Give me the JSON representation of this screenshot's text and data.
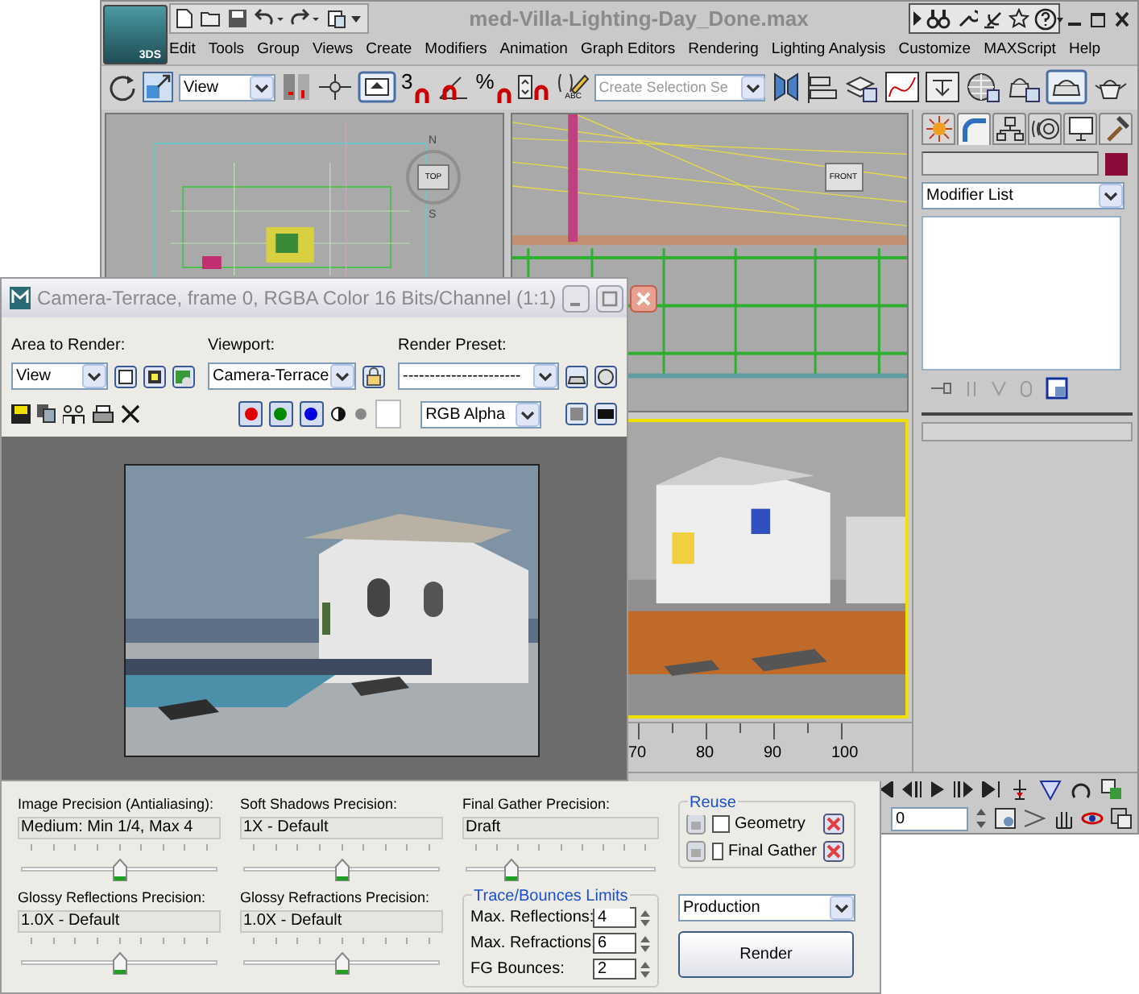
{
  "max_window": {
    "logo": "3DS",
    "title": "med-Villa-Lighting-Day_Done.max",
    "menu": [
      "Edit",
      "Tools",
      "Group",
      "Views",
      "Create",
      "Modifiers",
      "Animation",
      "Graph Editors",
      "Rendering",
      "Lighting Analysis",
      "Customize",
      "MAXScript",
      "Help"
    ],
    "toolbar": {
      "reference_coordinate": "View",
      "snap_label": "3",
      "percent_snap_label": "%",
      "named_selection_label": "ABC",
      "selection_set_placeholder": "Create Selection Se"
    },
    "viewports": {
      "top_view_cube": "TOP",
      "compass": [
        "N",
        "S"
      ],
      "front_view_cube": "FRONT"
    },
    "time_ruler": [
      "70",
      "80",
      "90",
      "100"
    ],
    "current_frame": "0"
  },
  "command_panel": {
    "tabs": [
      {
        "selected": false
      },
      {
        "selected": true
      },
      {
        "selected": false
      },
      {
        "selected": false
      },
      {
        "selected": false
      },
      {
        "selected": false
      }
    ],
    "modifier_list": "Modifier List"
  },
  "render_window": {
    "title": "Camera-Terrace, frame 0, RGBA Color 16 Bits/Channel (1:1)",
    "area_to_render": {
      "label": "Area to Render:",
      "value": "View"
    },
    "viewport": {
      "label": "Viewport:",
      "value": "Camera-Terrace"
    },
    "render_preset": {
      "label": "Render Preset:",
      "value": "----------------------"
    },
    "channels": [
      {
        "color": "#e00000",
        "on": true
      },
      {
        "color": "#008a00",
        "on": true
      },
      {
        "color": "#0000e0",
        "on": true
      }
    ],
    "display_channel": "RGB Alpha"
  },
  "render_settings": {
    "sliders": [
      {
        "label": "Image Precision (Antialiasing):",
        "value": "Medium: Min 1/4, Max 4",
        "level": 0.5
      },
      {
        "label": "Soft Shadows Precision:",
        "value": "1X - Default",
        "level": 0.5
      },
      {
        "label": "Glossy Reflections Precision:",
        "value": "1.0X - Default",
        "level": 0.5
      },
      {
        "label": "Glossy Refractions Precision:",
        "value": "1.0X - Default",
        "level": 0.5
      }
    ],
    "final_gather": {
      "label": "Final Gather Precision:",
      "value": "Draft",
      "level": 0.22
    },
    "reuse": {
      "title": "Reuse",
      "options": [
        {
          "label": "Geometry",
          "checked": false
        },
        {
          "label": "Final Gather",
          "checked": false
        }
      ]
    },
    "limits": {
      "title": "Trace/Bounces Limits",
      "rows": [
        {
          "label": "Max. Reflections:",
          "value": "4"
        },
        {
          "label": "Max. Refractions:",
          "value": "6"
        },
        {
          "label": "FG Bounces:",
          "value": "2"
        }
      ]
    },
    "preset": "Production",
    "render_button": "Render"
  }
}
